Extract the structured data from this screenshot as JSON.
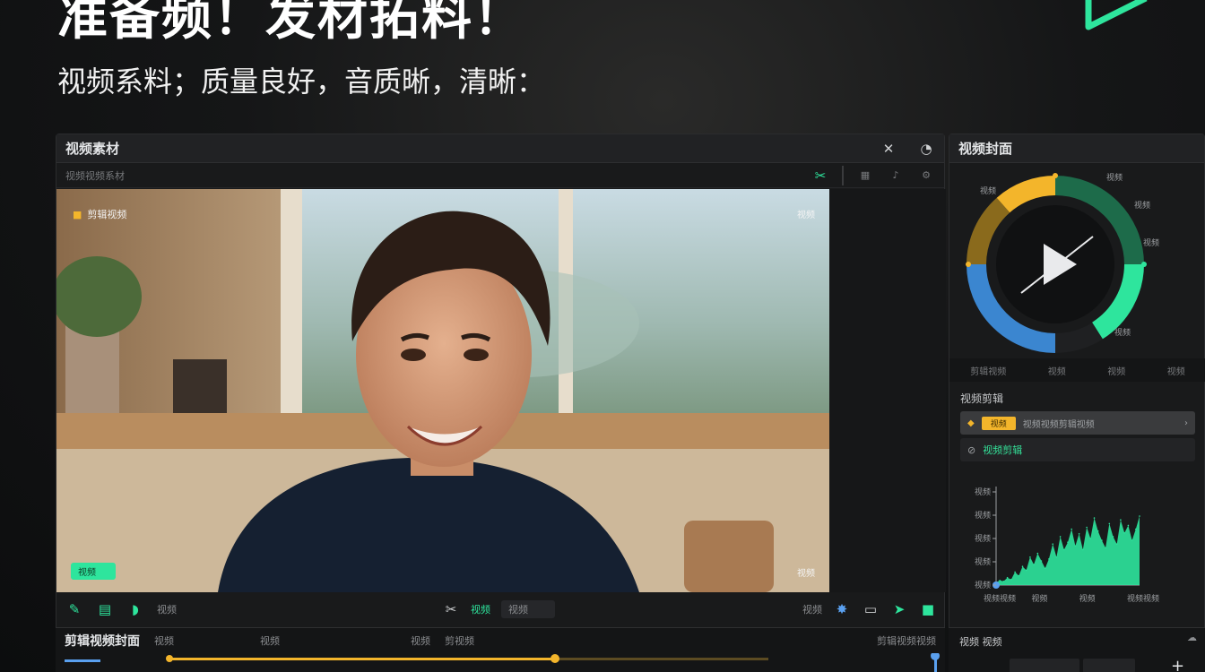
{
  "headline": "准备频！发材拓料！",
  "subline": "视频系料；质量良好，音质晰，清晰：",
  "accent": "#2ee59d",
  "gold": "#f3b52b",
  "blue": "#3b86d0",
  "editor": {
    "title": "视频素材",
    "sub_left": "视频视频系材",
    "overlay_tl": "剪辑视频",
    "overlay_tr": "视频",
    "overlay_br": "视频",
    "chip_label": "视频",
    "foot_left": "视频",
    "foot_center_a": "视频",
    "foot_center_b": "视频",
    "foot_right": "视频"
  },
  "timeline": {
    "title": "剪辑视频封面",
    "items": [
      "视频",
      "视频",
      "视频",
      "剪视频"
    ],
    "right_label": "剪辑视频视频"
  },
  "right": {
    "title": "视频封面",
    "tabs": [
      "剪辑视频",
      "视频",
      "视频",
      "视频"
    ],
    "section_label": "视频剪辑",
    "row1_badge": "视频",
    "row1_text": "视频视频剪辑视频",
    "row2_text": "视频剪辑",
    "donut_labels": [
      "视频",
      "视频",
      "视频",
      "视频",
      "视频"
    ],
    "bottom_label": "视频 视频"
  },
  "chart_data": {
    "type": "area",
    "title": "",
    "ylabels": [
      "视频",
      "视频",
      "视频",
      "视频",
      "视频"
    ],
    "xlabels": [
      "视频视频",
      "视频",
      "视频",
      "视频视频"
    ],
    "values": [
      3,
      5,
      4,
      8,
      6,
      14,
      10,
      20,
      16,
      30,
      22,
      34,
      26,
      18,
      28,
      44,
      30,
      52,
      38,
      46,
      60,
      42,
      55,
      38,
      62,
      50,
      72,
      58,
      48,
      40,
      66,
      52,
      44,
      70,
      56,
      64,
      48,
      60,
      74
    ],
    "ylim": [
      0,
      100
    ],
    "color": "#2ee59d"
  }
}
